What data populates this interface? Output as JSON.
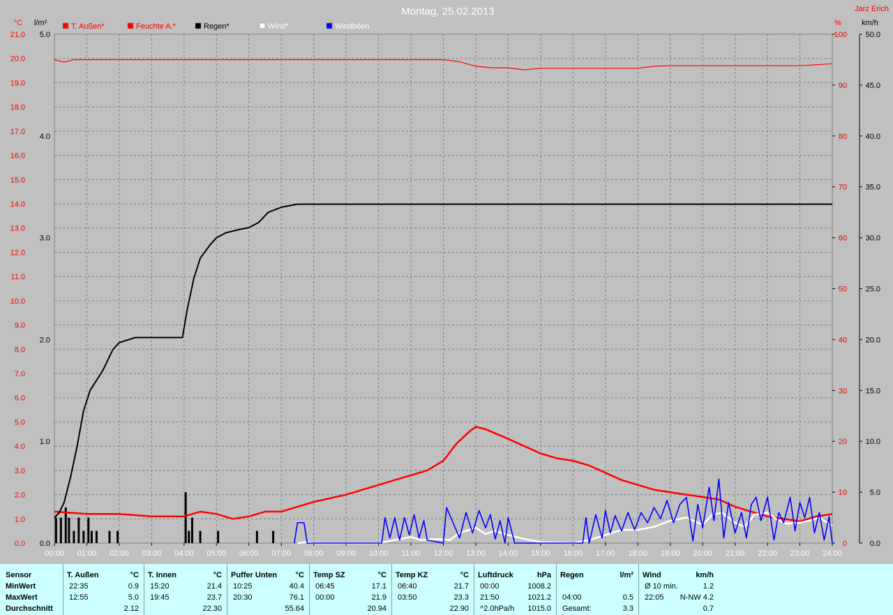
{
  "header": {
    "title": "Montag, 25.02.2013",
    "author": "Jarz Erich"
  },
  "colors": {
    "background": "#c0c0c0",
    "grid": "#808080",
    "temperature": "#ff0000",
    "humidity": "#ff0000",
    "rain": "#000000",
    "wind": "#ffffff",
    "gusts": "#0000ff",
    "panel": "#ccffff"
  },
  "legend": [
    {
      "label": "T. Außen*",
      "color": "#ff0000",
      "text_color": "#ff0000"
    },
    {
      "label": "Feuchte A.*",
      "color": "#ff0000",
      "text_color": "#ff0000"
    },
    {
      "label": "Regen*",
      "color": "#000000",
      "text_color": "#000000"
    },
    {
      "label": "Wind*",
      "color": "#ffffff",
      "text_color": "#ffffff"
    },
    {
      "label": "Windböen",
      "color": "#0000ff",
      "text_color": "#ffffff"
    }
  ],
  "chart_data": {
    "type": "line",
    "x_ticks": [
      "00:00",
      "01:00",
      "02:00",
      "03:00",
      "04:00",
      "05:00",
      "06:00",
      "07:00",
      "08:00",
      "09:00",
      "10:00",
      "11:00",
      "12:00",
      "13:00",
      "14:00",
      "15:00",
      "16:00",
      "17:00",
      "18:00",
      "19:00",
      "20:00",
      "21:00",
      "22:00",
      "23:00",
      "24:00"
    ],
    "axes": {
      "temp": {
        "unit": "°C",
        "range": [
          0,
          21
        ],
        "ticks": [
          "0.0",
          "1.0",
          "2.0",
          "3.0",
          "4.0",
          "5.0",
          "6.0",
          "7.0",
          "8.0",
          "9.0",
          "10.0",
          "11.0",
          "12.0",
          "13.0",
          "14.0",
          "15.0",
          "16.0",
          "17.0",
          "18.0",
          "19.0",
          "20.0",
          "21.0"
        ]
      },
      "rain": {
        "unit": "l/m²",
        "range": [
          0,
          5
        ],
        "ticks": [
          "0.0",
          "1.0",
          "2.0",
          "3.0",
          "4.0",
          "5.0"
        ]
      },
      "humidity": {
        "unit": "%",
        "range": [
          0,
          100
        ],
        "ticks": [
          "0",
          "10",
          "20",
          "30",
          "40",
          "50",
          "60",
          "70",
          "80",
          "90",
          "100"
        ]
      },
      "wind": {
        "unit": "km/h",
        "range": [
          0,
          50
        ],
        "ticks": [
          "0.0",
          "5.0",
          "10.0",
          "15.0",
          "20.0",
          "25.0",
          "30.0",
          "35.0",
          "40.0",
          "45.0",
          "50.0"
        ]
      }
    },
    "grid": true,
    "series": [
      {
        "name": "T. Außen*",
        "axis": "temp",
        "color": "#ff0000",
        "points": [
          [
            0,
            1.3
          ],
          [
            1,
            1.2
          ],
          [
            2,
            1.2
          ],
          [
            3,
            1.1
          ],
          [
            4,
            1.1
          ],
          [
            4.5,
            1.3
          ],
          [
            5,
            1.2
          ],
          [
            5.5,
            1.0
          ],
          [
            6,
            1.1
          ],
          [
            6.5,
            1.3
          ],
          [
            7,
            1.3
          ],
          [
            7.5,
            1.5
          ],
          [
            8,
            1.7
          ],
          [
            9,
            2.0
          ],
          [
            10,
            2.4
          ],
          [
            10.5,
            2.6
          ],
          [
            11,
            2.8
          ],
          [
            11.5,
            3.0
          ],
          [
            12,
            3.4
          ],
          [
            12.4,
            4.1
          ],
          [
            12.8,
            4.6
          ],
          [
            13,
            4.8
          ],
          [
            13.3,
            4.7
          ],
          [
            14,
            4.3
          ],
          [
            14.5,
            4.0
          ],
          [
            15,
            3.7
          ],
          [
            15.5,
            3.5
          ],
          [
            16,
            3.4
          ],
          [
            16.5,
            3.2
          ],
          [
            17,
            2.9
          ],
          [
            17.5,
            2.6
          ],
          [
            18,
            2.4
          ],
          [
            18.5,
            2.2
          ],
          [
            19,
            2.1
          ],
          [
            19.5,
            2.0
          ],
          [
            20,
            1.9
          ],
          [
            20.5,
            1.8
          ],
          [
            21,
            1.5
          ],
          [
            21.5,
            1.3
          ],
          [
            22,
            1.1
          ],
          [
            22.5,
            1.0
          ],
          [
            23,
            0.9
          ],
          [
            23.5,
            1.1
          ],
          [
            24,
            1.2
          ]
        ]
      },
      {
        "name": "Feuchte A.*",
        "axis": "humidity",
        "color": "#ff0000",
        "points": [
          [
            0,
            95
          ],
          [
            0.3,
            94.5
          ],
          [
            0.6,
            95
          ],
          [
            2,
            95
          ],
          [
            4,
            95
          ],
          [
            6,
            95
          ],
          [
            8,
            95
          ],
          [
            10,
            95
          ],
          [
            12,
            95
          ],
          [
            12.5,
            94.6
          ],
          [
            13,
            93.7
          ],
          [
            13.5,
            93.4
          ],
          [
            14,
            93.4
          ],
          [
            14.5,
            93.0
          ],
          [
            15,
            93.3
          ],
          [
            16,
            93.3
          ],
          [
            17,
            93.3
          ],
          [
            18,
            93.3
          ],
          [
            18.5,
            93.7
          ],
          [
            19,
            93.8
          ],
          [
            20,
            93.8
          ],
          [
            21,
            93.8
          ],
          [
            22,
            93.8
          ],
          [
            23,
            93.8
          ],
          [
            24,
            94.2
          ]
        ]
      },
      {
        "name": "Regen*",
        "axis": "rain",
        "color": "#000000",
        "points": [
          [
            0,
            0.25
          ],
          [
            0.15,
            0.3
          ],
          [
            0.3,
            0.4
          ],
          [
            0.5,
            0.65
          ],
          [
            0.7,
            0.95
          ],
          [
            0.9,
            1.3
          ],
          [
            1.1,
            1.5
          ],
          [
            1.5,
            1.7
          ],
          [
            1.8,
            1.9
          ],
          [
            2,
            1.97
          ],
          [
            2.5,
            2.02
          ],
          [
            3,
            2.02
          ],
          [
            3.5,
            2.02
          ],
          [
            3.95,
            2.02
          ],
          [
            4.1,
            2.3
          ],
          [
            4.3,
            2.6
          ],
          [
            4.5,
            2.8
          ],
          [
            4.8,
            2.93
          ],
          [
            5,
            3.0
          ],
          [
            5.3,
            3.05
          ],
          [
            5.7,
            3.08
          ],
          [
            6,
            3.1
          ],
          [
            6.3,
            3.15
          ],
          [
            6.6,
            3.25
          ],
          [
            7,
            3.3
          ],
          [
            7.5,
            3.33
          ],
          [
            8,
            3.33
          ],
          [
            10,
            3.33
          ],
          [
            12,
            3.33
          ],
          [
            14,
            3.33
          ],
          [
            16,
            3.33
          ],
          [
            18,
            3.33
          ],
          [
            20,
            3.33
          ],
          [
            22,
            3.33
          ],
          [
            24,
            3.33
          ]
        ]
      },
      {
        "name": "Wind*",
        "axis": "wind",
        "color": "#ffffff",
        "points": [
          [
            7.5,
            0
          ],
          [
            7.8,
            0.1
          ],
          [
            8,
            0
          ],
          [
            10,
            0
          ],
          [
            10.5,
            0.3
          ],
          [
            11,
            0.6
          ],
          [
            11.3,
            0.3
          ],
          [
            11.8,
            0.4
          ],
          [
            12.2,
            0.3
          ],
          [
            12.5,
            1.0
          ],
          [
            13,
            1.5
          ],
          [
            13.3,
            0.9
          ],
          [
            13.6,
            1.2
          ],
          [
            14,
            0.8
          ],
          [
            14.5,
            0.4
          ],
          [
            15,
            0.1
          ],
          [
            16,
            0
          ],
          [
            16.5,
            0.3
          ],
          [
            17,
            0.8
          ],
          [
            17.5,
            1.3
          ],
          [
            18,
            1.3
          ],
          [
            18.5,
            1.6
          ],
          [
            19,
            2.2
          ],
          [
            19.5,
            2.5
          ],
          [
            20,
            1.8
          ],
          [
            20.3,
            2.8
          ],
          [
            20.6,
            3.0
          ],
          [
            21,
            2.0
          ],
          [
            21.3,
            1.6
          ],
          [
            21.6,
            2.8
          ],
          [
            22,
            3.0
          ],
          [
            22.3,
            2.3
          ],
          [
            22.6,
            1.9
          ],
          [
            23,
            2.0
          ],
          [
            23.3,
            2.2
          ],
          [
            23.6,
            2.5
          ],
          [
            24,
            1.7
          ]
        ]
      },
      {
        "name": "Windböen",
        "axis": "wind",
        "color": "#0000ff",
        "points": [
          [
            7.4,
            0
          ],
          [
            7.5,
            2.0
          ],
          [
            7.7,
            2.0
          ],
          [
            7.8,
            0
          ],
          [
            10.1,
            0
          ],
          [
            10.2,
            2.5
          ],
          [
            10.35,
            0.5
          ],
          [
            10.5,
            2.5
          ],
          [
            10.65,
            0.3
          ],
          [
            10.8,
            2.5
          ],
          [
            10.95,
            0.8
          ],
          [
            11.1,
            2.8
          ],
          [
            11.25,
            0.5
          ],
          [
            11.4,
            2.2
          ],
          [
            11.5,
            0.3
          ],
          [
            12,
            0
          ],
          [
            12.1,
            3.5
          ],
          [
            12.3,
            2.0
          ],
          [
            12.5,
            0.5
          ],
          [
            12.7,
            3.0
          ],
          [
            12.9,
            1.0
          ],
          [
            13.1,
            3.2
          ],
          [
            13.3,
            1.5
          ],
          [
            13.45,
            2.8
          ],
          [
            13.6,
            0.4
          ],
          [
            13.75,
            2.2
          ],
          [
            13.9,
            0
          ],
          [
            14,
            2.5
          ],
          [
            14.2,
            0
          ],
          [
            16.3,
            0
          ],
          [
            16.4,
            2.5
          ],
          [
            16.5,
            0
          ],
          [
            16.7,
            2.8
          ],
          [
            16.9,
            0.5
          ],
          [
            17,
            3.2
          ],
          [
            17.15,
            1.0
          ],
          [
            17.3,
            2.7
          ],
          [
            17.5,
            1.2
          ],
          [
            17.7,
            3.0
          ],
          [
            17.9,
            1.3
          ],
          [
            18.1,
            3.0
          ],
          [
            18.3,
            2.0
          ],
          [
            18.5,
            3.5
          ],
          [
            18.7,
            2.4
          ],
          [
            18.9,
            4.2
          ],
          [
            19.1,
            2.0
          ],
          [
            19.3,
            3.8
          ],
          [
            19.5,
            4.5
          ],
          [
            19.7,
            0.2
          ],
          [
            19.85,
            3.8
          ],
          [
            20,
            1.5
          ],
          [
            20.2,
            5.5
          ],
          [
            20.35,
            2.2
          ],
          [
            20.5,
            6.3
          ],
          [
            20.65,
            0.5
          ],
          [
            20.8,
            4.0
          ],
          [
            21,
            1.0
          ],
          [
            21.2,
            3.0
          ],
          [
            21.35,
            0.5
          ],
          [
            21.5,
            3.8
          ],
          [
            21.65,
            4.5
          ],
          [
            21.8,
            2.2
          ],
          [
            22,
            4.5
          ],
          [
            22.2,
            0.3
          ],
          [
            22.35,
            3.0
          ],
          [
            22.5,
            2.0
          ],
          [
            22.7,
            4.5
          ],
          [
            22.85,
            1.2
          ],
          [
            23,
            4.0
          ],
          [
            23.15,
            2.5
          ],
          [
            23.3,
            4.5
          ],
          [
            23.45,
            1.0
          ],
          [
            23.6,
            3.0
          ],
          [
            23.75,
            0.3
          ],
          [
            23.9,
            2.6
          ],
          [
            24,
            0
          ]
        ]
      }
    ],
    "rain_bars": {
      "name": "Regen",
      "axis": "rain",
      "color": "#000000",
      "points": [
        [
          0.05,
          0.25
        ],
        [
          0.2,
          0.25
        ],
        [
          0.35,
          0.35
        ],
        [
          0.45,
          0.25
        ],
        [
          0.6,
          0.12
        ],
        [
          0.75,
          0.25
        ],
        [
          0.9,
          0.12
        ],
        [
          1.05,
          0.25
        ],
        [
          1.15,
          0.12
        ],
        [
          1.3,
          0.12
        ],
        [
          1.7,
          0.12
        ],
        [
          1.95,
          0.12
        ],
        [
          4.05,
          0.5
        ],
        [
          4.15,
          0.12
        ],
        [
          4.25,
          0.25
        ],
        [
          4.5,
          0.12
        ],
        [
          5.05,
          0.12
        ],
        [
          6.25,
          0.12
        ],
        [
          6.75,
          0.12
        ]
      ]
    }
  },
  "stats": {
    "row_labels": [
      "Sensor",
      "MinWert",
      "MaxWert",
      "Durchschnitt"
    ],
    "columns": [
      {
        "name": "T. Außen",
        "unit": "°C",
        "rows": [
          [
            "22:35",
            "0.9"
          ],
          [
            "12:55",
            "5.0"
          ],
          [
            "",
            "2.12"
          ]
        ]
      },
      {
        "name": "T. Innen",
        "unit": "°C",
        "rows": [
          [
            "15:20",
            "21.4"
          ],
          [
            "19:45",
            "23.7"
          ],
          [
            "",
            "22.30"
          ]
        ]
      },
      {
        "name": "Puffer Unten",
        "unit": "°C",
        "rows": [
          [
            "10:25",
            "40.4"
          ],
          [
            "20:30",
            "76.1"
          ],
          [
            "",
            "55.64"
          ]
        ]
      },
      {
        "name": "Temp SZ",
        "unit": "°C",
        "rows": [
          [
            "06:45",
            "17.1"
          ],
          [
            "00:00",
            "21.9"
          ],
          [
            "",
            "20.94"
          ]
        ]
      },
      {
        "name": "Temp KZ",
        "unit": "°C",
        "rows": [
          [
            "06:40",
            "21.7"
          ],
          [
            "03:50",
            "23.3"
          ],
          [
            "",
            "22.90"
          ]
        ]
      },
      {
        "name": "Luftdruck",
        "unit": "hPa",
        "rows": [
          [
            "00:00",
            "1008.2"
          ],
          [
            "21:50",
            "1021.2"
          ],
          [
            "^2.0hPa/h",
            "1015.0"
          ]
        ]
      },
      {
        "name": "Regen",
        "unit": "l/m²",
        "rows": [
          [
            "",
            ""
          ],
          [
            "04:00",
            "0.5"
          ],
          [
            "Gesamt:",
            "3.3"
          ]
        ]
      },
      {
        "name": "Wind",
        "unit": "km/h",
        "rows": [
          [
            "Ø 10 min.",
            "1.2"
          ],
          [
            "22:05",
            "N-NW 4.2"
          ],
          [
            "",
            "0.7"
          ]
        ]
      }
    ]
  }
}
